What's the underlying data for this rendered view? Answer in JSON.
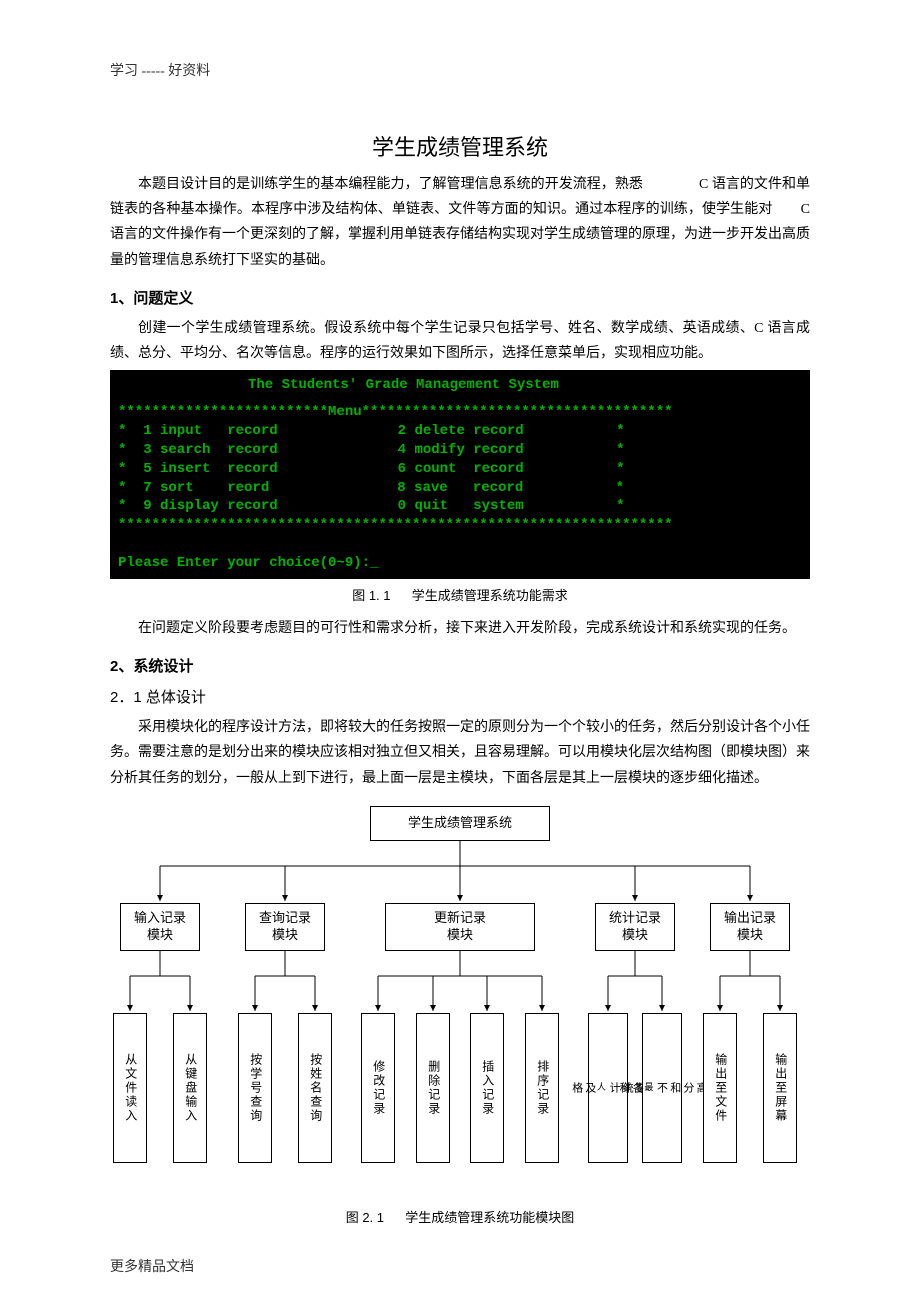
{
  "header_note": "学习 ----- 好资料",
  "title": "学生成绩管理系统",
  "intro_text": "本题目设计目的是训练学生的基本编程能力，了解管理信息系统的开发流程，熟悉　　　　C 语言的文件和单链表的各种基本操作。本程序中涉及结构体、单链表、文件等方面的知识。通过本程序的训练，使学生能对　　C 语言的文件操作有一个更深刻的了解，掌握利用单链表存储结构实现对学生成绩管理的原理，为进一步开发出高质量的管理信息系统打下坚实的基础。",
  "sec1_heading": "1、问题定义",
  "sec1_para": "创建一个学生成绩管理系统。假设系统中每个学生记录只包括学号、姓名、数学成绩、英语成绩、C 语言成绩、总分、平均分、名次等信息。程序的运行效果如下图所示，选择任意菜单后，实现相应功能。",
  "console": {
    "title": "The Students' Grade Management System",
    "border_top": "*************************Menu*************************************",
    "rows": [
      {
        "left": "*  1 input   record",
        "right": "2 delete record           *"
      },
      {
        "left": "*  3 search  record",
        "right": "4 modify record           *"
      },
      {
        "left": "*  5 insert  record",
        "right": "6 count  record           *"
      },
      {
        "left": "*  7 sort    reord",
        "right": "8 save   record           *"
      },
      {
        "left": "*  9 display record",
        "right": "0 quit   system           *"
      }
    ],
    "border_bottom": "******************************************************************",
    "prompt": "Please Enter your choice(0~9):_"
  },
  "fig1_num": "图 1. 1",
  "fig1_cap": "学生成绩管理系统功能需求",
  "sec1_para2": "在问题定义阶段要考虑题目的可行性和需求分析，接下来进入开发阶段，完成系统设计和系统实现的任务。",
  "sec2_heading": "2、系统设计",
  "sec21_heading": "2．1 总体设计",
  "sec21_para": "采用模块化的程序设计方法，即将较大的任务按照一定的原则分为一个个较小的任务，然后分别设计各个小任务。需要注意的是划分出来的模块应该相对独立但又相关，且容易理解。可以用模块化层次结构图（即模块图）来分析其任务的划分，一般从上到下进行，最上面一层是主模块，下面各层是其上一层模块的逐步细化描述。",
  "diagram": {
    "root": "学生成绩管理系统",
    "level2": [
      "输入记录\n模块",
      "查询记录\n模块",
      "更新记录\n模块",
      "统计记录\n模块",
      "输出记录\n模块"
    ],
    "level3": [
      "从文件读入",
      "从键盘输入",
      "按学号查询",
      "按姓名查询",
      "修改记录",
      "删除记录",
      "插入记录",
      "排序记录",
      "及格人数统计",
      "各科最高分和不",
      "输出至文件",
      "输出至屏幕"
    ]
  },
  "fig2_num": "图 2. 1",
  "fig2_cap": "学生成绩管理系统功能模块图",
  "footer_note": "更多精品文档"
}
